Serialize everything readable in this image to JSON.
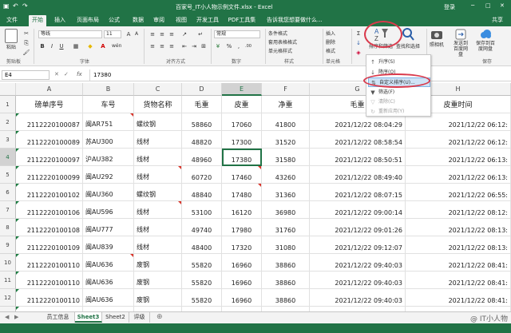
{
  "titlebar": {
    "filename": "百家号_IT小人物示例文件.xlsx - Excel",
    "login": "登录",
    "min": "─",
    "max": "□",
    "close": "✕",
    "save": "▣",
    "undo": "↶",
    "redo": "↷"
  },
  "ribbon_tabs": {
    "file": "文件",
    "home": "开始",
    "insert": "插入",
    "layout": "页面布局",
    "formula": "公式",
    "data": "数据",
    "review": "审阅",
    "view": "视图",
    "dev": "开发工具",
    "pdf": "PDF工具集",
    "tellme": "告诉我您想要做什么...",
    "share": "共享"
  },
  "ribbon": {
    "paste": "粘贴",
    "clipboard": "剪贴板",
    "font_name": "等线",
    "font_size": "11",
    "bold": "B",
    "italic": "I",
    "underline": "U",
    "font_group": "字体",
    "align_group": "对齐方式",
    "number_format": "常规",
    "number_group": "数字",
    "cond_format": "条件格式",
    "table_format": "套用表格格式",
    "cell_style": "单元格样式",
    "styles_group": "样式",
    "insert_cell": "插入",
    "delete_cell": "删除",
    "format_cell": "格式",
    "cells_group": "单元格",
    "sort_filter": "排序和筛选",
    "find_select": "查找和选择",
    "camera": "照相机",
    "send_baidu": "发送到百度网盘",
    "save_baidu": "保存到百度网盘",
    "save_group": "保存"
  },
  "sort_menu": {
    "asc": "升序(S)",
    "desc": "降序(O)",
    "custom": "自定义排序(U)...",
    "filter": "筛选(F)",
    "clear": "清除(C)",
    "reapply": "重新应用(Y)"
  },
  "formula_bar": {
    "name_box": "E4",
    "fx": "fx",
    "value": "17380",
    "cancel": "✕",
    "enter": "✓"
  },
  "columns": [
    "A",
    "B",
    "C",
    "D",
    "E",
    "F",
    "G",
    "H"
  ],
  "rows": [
    "1",
    "2",
    "3",
    "4",
    "5",
    "6",
    "7",
    "8",
    "9",
    "10",
    "11",
    "12",
    "13"
  ],
  "headers": [
    "磅单序号",
    "车号",
    "货物名称",
    "毛重",
    "皮重",
    "净重",
    "毛重",
    "皮重时间"
  ],
  "table": [
    [
      "2112220100087",
      "闽AR751",
      "螺纹钢",
      "58860",
      "17060",
      "41800",
      "2021/12/22 08:04:29",
      "2021/12/22 06:12:"
    ],
    [
      "2112220100089",
      "苏AU300",
      "线材",
      "48820",
      "17300",
      "31520",
      "2021/12/22 08:58:54",
      "2021/12/22 06:12:"
    ],
    [
      "2112220100097",
      "沪AU382",
      "线材",
      "48960",
      "17380",
      "31580",
      "2021/12/22 08:50:51",
      "2021/12/22 06:13:"
    ],
    [
      "2112220100099",
      "闽AU292",
      "线材",
      "60720",
      "17460",
      "43260",
      "2021/12/22 08:49:40",
      "2021/12/22 06:13:"
    ],
    [
      "2112220100102",
      "闽AU360",
      "螺纹钢",
      "48840",
      "17480",
      "31360",
      "2021/12/22 08:07:15",
      "2021/12/22 06:55:"
    ],
    [
      "2112220100106",
      "闽AU596",
      "线材",
      "53100",
      "16120",
      "36980",
      "2021/12/22 09:00:14",
      "2021/12/22 08:12:"
    ],
    [
      "2112220100108",
      "闽AU777",
      "线材",
      "49740",
      "17980",
      "31760",
      "2021/12/22 09:01:26",
      "2021/12/22 08:13:"
    ],
    [
      "2112220100109",
      "闽AU839",
      "线材",
      "48400",
      "17320",
      "31080",
      "2021/12/22 09:12:07",
      "2021/12/22 08:13:"
    ],
    [
      "2112220100110",
      "闽AU636",
      "废钢",
      "55820",
      "16960",
      "38860",
      "2021/12/22 09:40:03",
      "2021/12/22 08:41:"
    ],
    [
      "2112220100110",
      "闽AU636",
      "废钢",
      "55820",
      "16960",
      "38860",
      "2021/12/22 09:40:03",
      "2021/12/22 08:41:"
    ],
    [
      "2112220100110",
      "闽AU636",
      "废钢",
      "55820",
      "16960",
      "38860",
      "2021/12/22 09:40:03",
      "2021/12/22 08:41:"
    ],
    [
      "2112220100110",
      "闽AU636",
      "废钢",
      "55820",
      "16960",
      "38860",
      "2021/12/22 09:40:03",
      "2021/12/22 08:41:"
    ]
  ],
  "sheets": [
    "员工信息",
    "Sheet3",
    "Sheet2",
    "评级"
  ],
  "sheet_nav": {
    "prev": "◀",
    "next": "▶",
    "add": "⊕"
  },
  "watermark": "@ IT小人物",
  "colors": {
    "excel_green": "#217346",
    "annotation_red": "#d93a4c",
    "menu_highlight": "#cfe3f6"
  }
}
